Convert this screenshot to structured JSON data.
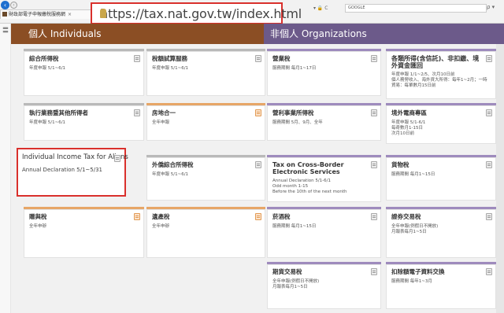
{
  "browser": {
    "tab_title": "財政部電子申報繳稅服務網",
    "tab_close": "×",
    "back_icon": "back-arrow-icon",
    "forward_icon": "forward-arrow-icon",
    "url": "https://tax.nat.gov.tw/index.html",
    "address_icons": "▾ 🔒 C",
    "search_placeholder": "GOOGLE",
    "search_icon": "ρ ▾"
  },
  "sidebar": {
    "menu_icon": "〓"
  },
  "sections": {
    "individuals": {
      "title": "個人 Individuals",
      "color": "#8b4e24"
    },
    "organizations": {
      "title": "非個人 Organizations",
      "color": "#6c5a8a"
    }
  },
  "individual_cards": [
    {
      "title": "綜合所得稅",
      "desc": "年度申報 5/1~6/1",
      "accent": "gray"
    },
    {
      "title": "稅額試算服務",
      "desc": "年度申報 5/1~6/1",
      "accent": "gray"
    },
    {
      "title": "執行業務暨其他所得者",
      "desc": "年度申報 5/1~6/1",
      "accent": "gray"
    },
    {
      "title": "房地合一",
      "desc": "全年申報",
      "accent": "orange"
    },
    {
      "title": "Individual Income Tax for Aliens",
      "desc": "Annual Declaration  5/1~5/31",
      "accent": "gray"
    },
    {
      "title": "外僑綜合所得稅",
      "desc": "年度申報 5/1~6/1",
      "accent": "gray"
    },
    {
      "title": "贈與稅",
      "desc": "全年申辦",
      "accent": "orange"
    },
    {
      "title": "遺產稅",
      "desc": "全年申辦",
      "accent": "orange"
    }
  ],
  "org_cards": [
    {
      "title": "營業稅",
      "desc": "服務期間 每月1~17日",
      "accent": "purple"
    },
    {
      "title": "各類所得(含信託)、非扣繳、境外資金匯回",
      "desc": "年度申報 1/1~2/5、次月10日前\n個人務勞收入、海外資大所得：每年1~2月；一時貿易：每單數月15日前",
      "accent": "purple"
    },
    {
      "title": "營利事業所得稅",
      "desc": "服務期間 5月、9月、全年",
      "accent": "purple"
    },
    {
      "title": "境外電商專區",
      "desc": "年度申報 5/1-6/1\n每奇數月1-15日\n次月10日前",
      "accent": "purple"
    },
    {
      "title": "Tax on Cross-Border Electronic Services",
      "desc": "Annual Declaration 5/1-6/1\nOdd month 1-15\nBefore the 10th of the next month",
      "accent": "purple"
    },
    {
      "title": "貨物稅",
      "desc": "服務期間 每月1~15日",
      "accent": "purple"
    },
    {
      "title": "菸酒稅",
      "desc": "服務期間 每月1~15日",
      "accent": "purple"
    },
    {
      "title": "證券交易稅",
      "desc": "全年申報(例假日不開放)\n月報表每月1~5日",
      "accent": "purple"
    },
    {
      "title": "期貨交易稅",
      "desc": "全年申報(例假日不開放)\n月報表每月1~5日",
      "accent": "purple"
    },
    {
      "title": "扣除額電子資料交換",
      "desc": "服務期間 每年1~3月",
      "accent": "purple"
    }
  ],
  "colors": {
    "highlight": "#d9302c",
    "card_gray": "#b9b9b9",
    "card_orange": "#e7a667",
    "card_purple": "#9e8bbd"
  }
}
